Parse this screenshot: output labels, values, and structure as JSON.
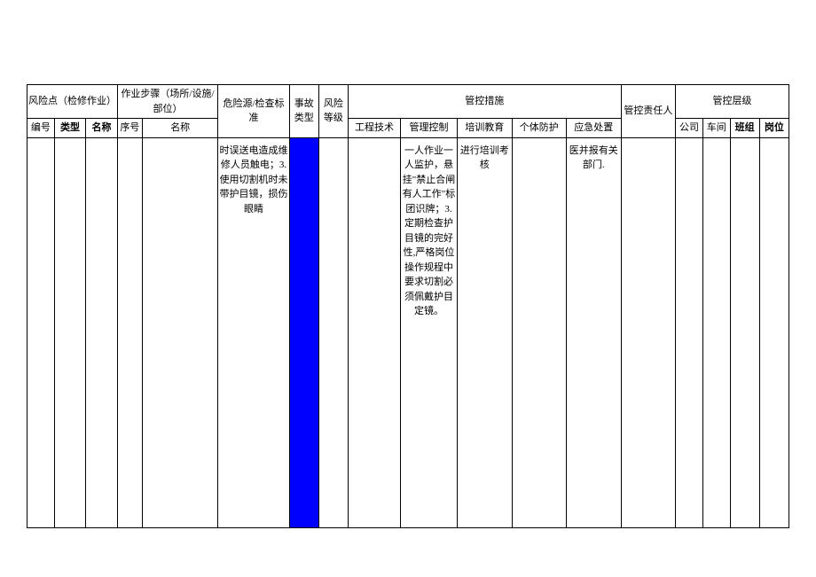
{
  "header": {
    "riskPoint": "风险点（检修作业）",
    "workStep": "作业步骤（场所/设施/部位）",
    "hazard": "危险源/检查标准",
    "accidentType": "事故类型",
    "riskLevel": "风险等级",
    "controlMeasures": "管控措施",
    "responsible": "管控责任人",
    "controlLevel": "管控层级",
    "num": "编号",
    "type": "类型",
    "name": "名称",
    "seq": "序号",
    "stepName": "名称",
    "engineering": "工程技术",
    "management": "管理控制",
    "training": "培训教育",
    "ppe": "个体防护",
    "emergency": "应急处置",
    "company": "公司",
    "workshop": "车间",
    "team": "班组",
    "post": "岗位"
  },
  "row": {
    "hazard": "时误送电造成维修人员触电；3.使用切割机时未带护目镜，损伤眼睛",
    "management": "一人作业一人监护，悬挂\"禁止合闸有人工作\"标团识牌；3. 定期检查护目镜的完好性,严格岗位操作规程中要求切割必须佩戴护目定镜。",
    "training": "进行培训考核",
    "emergency": "医并报有关部门."
  }
}
